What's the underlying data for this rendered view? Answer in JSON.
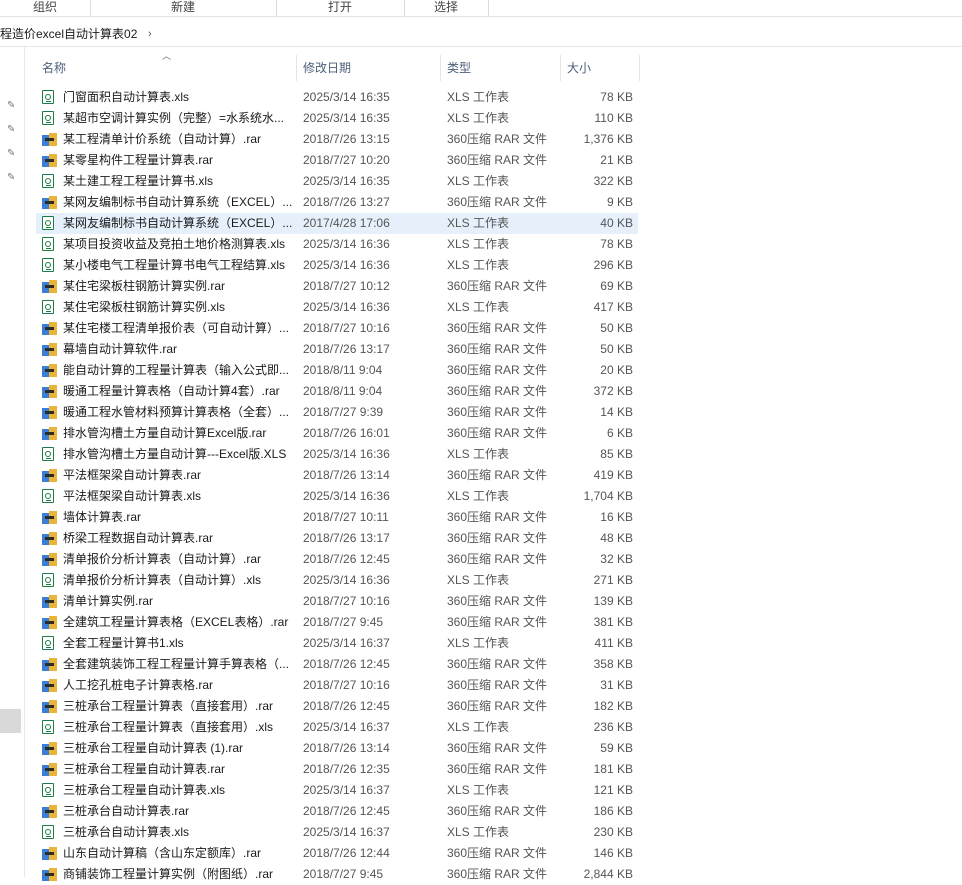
{
  "ribbon": {
    "groups": [
      "组织",
      "新建",
      "打开",
      "选择"
    ]
  },
  "address": {
    "path": "程造价excel自动计算表02",
    "chevron": "›"
  },
  "columns": {
    "name": "名称",
    "date": "修改日期",
    "type": "类型",
    "size": "大小"
  },
  "files": [
    {
      "name": "门窗面积自动计算表.xls",
      "date": "2025/3/14 16:35",
      "type": "XLS 工作表",
      "size": "78 KB",
      "icon": "xls-icon"
    },
    {
      "name": "某超市空调计算实例（完整）=水系统水...",
      "date": "2025/3/14 16:35",
      "type": "XLS 工作表",
      "size": "110 KB",
      "icon": "xls-icon"
    },
    {
      "name": "某工程清单计价系统（自动计算）.rar",
      "date": "2018/7/26 13:15",
      "type": "360压缩 RAR 文件",
      "size": "1,376 KB",
      "icon": "rar-icon"
    },
    {
      "name": "某零星构件工程量计算表.rar",
      "date": "2018/7/27 10:20",
      "type": "360压缩 RAR 文件",
      "size": "21 KB",
      "icon": "rar-icon"
    },
    {
      "name": "某土建工程工程量计算书.xls",
      "date": "2025/3/14 16:35",
      "type": "XLS 工作表",
      "size": "322 KB",
      "icon": "xls-icon"
    },
    {
      "name": "某网友编制标书自动计算系统（EXCEL）...",
      "date": "2018/7/26 13:27",
      "type": "360压缩 RAR 文件",
      "size": "9 KB",
      "icon": "rar-icon"
    },
    {
      "name": "某网友编制标书自动计算系统（EXCEL）...",
      "date": "2017/4/28 17:06",
      "type": "XLS 工作表",
      "size": "40 KB",
      "icon": "xls-icon",
      "selected": true
    },
    {
      "name": "某项目投资收益及竞拍土地价格测算表.xls",
      "date": "2025/3/14 16:36",
      "type": "XLS 工作表",
      "size": "78 KB",
      "icon": "xls-icon"
    },
    {
      "name": "某小楼电气工程量计算书电气工程结算.xls",
      "date": "2025/3/14 16:36",
      "type": "XLS 工作表",
      "size": "296 KB",
      "icon": "xls-icon"
    },
    {
      "name": "某住宅梁板柱钢筋计算实例.rar",
      "date": "2018/7/27 10:12",
      "type": "360压缩 RAR 文件",
      "size": "69 KB",
      "icon": "rar-icon"
    },
    {
      "name": "某住宅梁板柱钢筋计算实例.xls",
      "date": "2025/3/14 16:36",
      "type": "XLS 工作表",
      "size": "417 KB",
      "icon": "xls-icon"
    },
    {
      "name": "某住宅楼工程清单报价表（可自动计算）...",
      "date": "2018/7/27 10:16",
      "type": "360压缩 RAR 文件",
      "size": "50 KB",
      "icon": "rar-icon"
    },
    {
      "name": "幕墙自动计算软件.rar",
      "date": "2018/7/26 13:17",
      "type": "360压缩 RAR 文件",
      "size": "50 KB",
      "icon": "rar-icon"
    },
    {
      "name": "能自动计算的工程量计算表（输入公式即...",
      "date": "2018/8/11 9:04",
      "type": "360压缩 RAR 文件",
      "size": "20 KB",
      "icon": "rar-icon"
    },
    {
      "name": "暖通工程量计算表格（自动计算4套）.rar",
      "date": "2018/8/11 9:04",
      "type": "360压缩 RAR 文件",
      "size": "372 KB",
      "icon": "rar-icon"
    },
    {
      "name": "暖通工程水管材料预算计算表格（全套）...",
      "date": "2018/7/27 9:39",
      "type": "360压缩 RAR 文件",
      "size": "14 KB",
      "icon": "rar-icon"
    },
    {
      "name": "排水管沟槽土方量自动计算Excel版.rar",
      "date": "2018/7/26 16:01",
      "type": "360压缩 RAR 文件",
      "size": "6 KB",
      "icon": "rar-icon"
    },
    {
      "name": "排水管沟槽土方量自动计算---Excel版.XLS",
      "date": "2025/3/14 16:36",
      "type": "XLS 工作表",
      "size": "85 KB",
      "icon": "xls-icon"
    },
    {
      "name": "平法框架梁自动计算表.rar",
      "date": "2018/7/26 13:14",
      "type": "360压缩 RAR 文件",
      "size": "419 KB",
      "icon": "rar-icon"
    },
    {
      "name": "平法框架梁自动计算表.xls",
      "date": "2025/3/14 16:36",
      "type": "XLS 工作表",
      "size": "1,704 KB",
      "icon": "xls-icon"
    },
    {
      "name": "墙体计算表.rar",
      "date": "2018/7/27 10:11",
      "type": "360压缩 RAR 文件",
      "size": "16 KB",
      "icon": "rar-icon"
    },
    {
      "name": "桥梁工程数据自动计算表.rar",
      "date": "2018/7/26 13:17",
      "type": "360压缩 RAR 文件",
      "size": "48 KB",
      "icon": "rar-icon"
    },
    {
      "name": "清单报价分析计算表（自动计算）.rar",
      "date": "2018/7/26 12:45",
      "type": "360压缩 RAR 文件",
      "size": "32 KB",
      "icon": "rar-icon"
    },
    {
      "name": "清单报价分析计算表（自动计算）.xls",
      "date": "2025/3/14 16:36",
      "type": "XLS 工作表",
      "size": "271 KB",
      "icon": "xls-icon"
    },
    {
      "name": "清单计算实例.rar",
      "date": "2018/7/27 10:16",
      "type": "360压缩 RAR 文件",
      "size": "139 KB",
      "icon": "rar-icon"
    },
    {
      "name": "全建筑工程量计算表格（EXCEL表格）.rar",
      "date": "2018/7/27 9:45",
      "type": "360压缩 RAR 文件",
      "size": "381 KB",
      "icon": "rar-icon"
    },
    {
      "name": "全套工程量计算书1.xls",
      "date": "2025/3/14 16:37",
      "type": "XLS 工作表",
      "size": "411 KB",
      "icon": "xls-icon"
    },
    {
      "name": "全套建筑装饰工程工程量计算手算表格（...",
      "date": "2018/7/26 12:45",
      "type": "360压缩 RAR 文件",
      "size": "358 KB",
      "icon": "rar-icon"
    },
    {
      "name": "人工挖孔桩电子计算表格.rar",
      "date": "2018/7/27 10:16",
      "type": "360压缩 RAR 文件",
      "size": "31 KB",
      "icon": "rar-icon"
    },
    {
      "name": "三桩承台工程量计算表（直接套用）.rar",
      "date": "2018/7/26 12:45",
      "type": "360压缩 RAR 文件",
      "size": "182 KB",
      "icon": "rar-icon"
    },
    {
      "name": "三桩承台工程量计算表（直接套用）.xls",
      "date": "2025/3/14 16:37",
      "type": "XLS 工作表",
      "size": "236 KB",
      "icon": "xls-icon"
    },
    {
      "name": "三桩承台工程量自动计算表 (1).rar",
      "date": "2018/7/26 13:14",
      "type": "360压缩 RAR 文件",
      "size": "59 KB",
      "icon": "rar-icon"
    },
    {
      "name": "三桩承台工程量自动计算表.rar",
      "date": "2018/7/26 12:35",
      "type": "360压缩 RAR 文件",
      "size": "181 KB",
      "icon": "rar-icon"
    },
    {
      "name": "三桩承台工程量自动计算表.xls",
      "date": "2025/3/14 16:37",
      "type": "XLS 工作表",
      "size": "121 KB",
      "icon": "xls-icon"
    },
    {
      "name": "三桩承台自动计算表.rar",
      "date": "2018/7/26 12:45",
      "type": "360压缩 RAR 文件",
      "size": "186 KB",
      "icon": "rar-icon"
    },
    {
      "name": "三桩承台自动计算表.xls",
      "date": "2025/3/14 16:37",
      "type": "XLS 工作表",
      "size": "230 KB",
      "icon": "xls-icon"
    },
    {
      "name": "山东自动计算稿（含山东定额库）.rar",
      "date": "2018/7/26 12:44",
      "type": "360压缩 RAR 文件",
      "size": "146 KB",
      "icon": "rar-icon"
    },
    {
      "name": "商铺装饰工程量计算实例（附图纸）.rar",
      "date": "2018/7/27 9:45",
      "type": "360压缩 RAR 文件",
      "size": "2,844 KB",
      "icon": "rar-icon"
    }
  ]
}
